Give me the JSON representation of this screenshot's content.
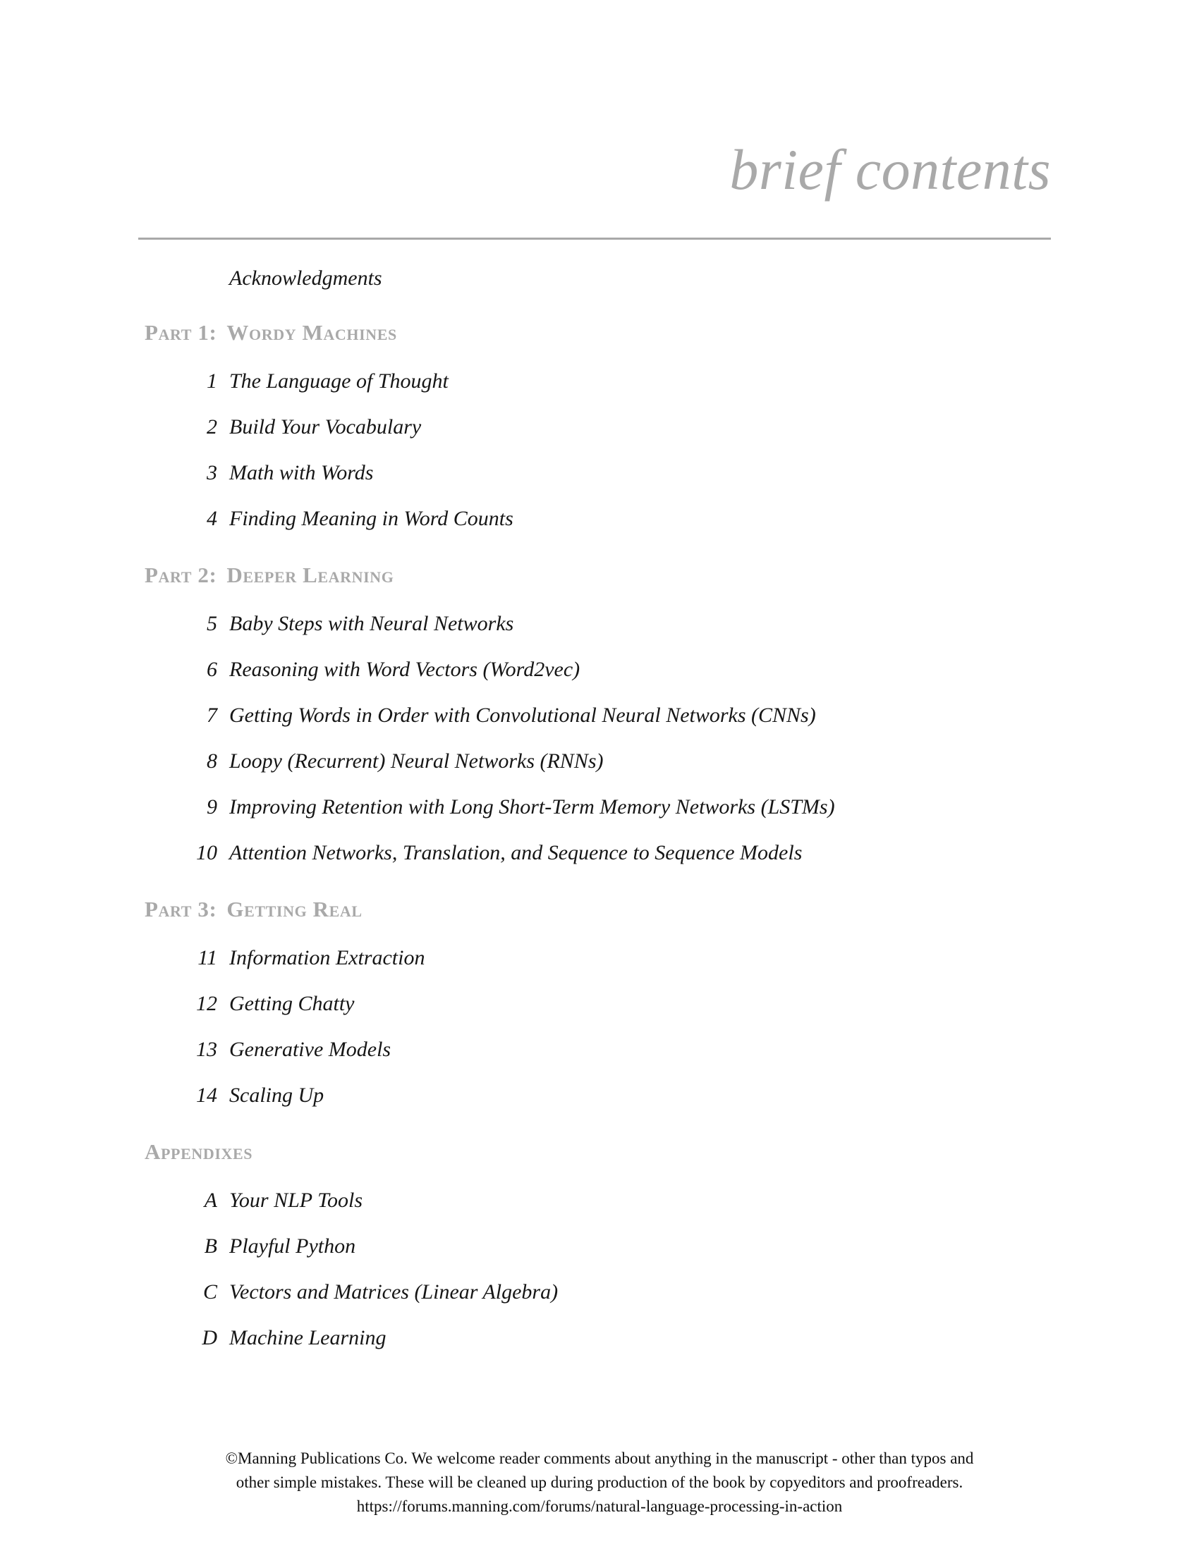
{
  "header": {
    "title": "brief contents",
    "rule_color": "#a9a9a9"
  },
  "colors": {
    "heading_gray": "#a9a9a9",
    "body_black": "#161616",
    "page_background": "#ffffff"
  },
  "contents": {
    "frontmatter": [
      {
        "label": "Acknowledgments"
      }
    ],
    "parts": [
      {
        "kicker": "Part 1:",
        "name": "Wordy Machines",
        "chapters": [
          {
            "number": "1",
            "title": "The Language of Thought"
          },
          {
            "number": "2",
            "title": "Build Your Vocabulary"
          },
          {
            "number": "3",
            "title": "Math with Words"
          },
          {
            "number": "4",
            "title": "Finding Meaning in Word Counts"
          }
        ]
      },
      {
        "kicker": "Part 2:",
        "name": "Deeper Learning",
        "chapters": [
          {
            "number": "5",
            "title": "Baby Steps with Neural Networks"
          },
          {
            "number": "6",
            "title": "Reasoning with Word Vectors (Word2vec)"
          },
          {
            "number": "7",
            "title": "Getting Words in Order with Convolutional Neural Networks (CNNs)"
          },
          {
            "number": "8",
            "title": "Loopy (Recurrent) Neural Networks (RNNs)"
          },
          {
            "number": "9",
            "title": "Improving Retention with Long Short-Term Memory Networks (LSTMs)"
          },
          {
            "number": "10",
            "title": "Attention Networks, Translation, and Sequence to Sequence Models"
          }
        ]
      },
      {
        "kicker": "Part 3:",
        "name": "Getting Real",
        "chapters": [
          {
            "number": "11",
            "title": "Information Extraction"
          },
          {
            "number": "12",
            "title": "Getting Chatty"
          },
          {
            "number": "13",
            "title": "Generative Models"
          },
          {
            "number": "14",
            "title": "Scaling Up"
          }
        ]
      }
    ],
    "appendixes": {
      "name": "Appendixes",
      "items": [
        {
          "number": "A",
          "title": "Your NLP Tools"
        },
        {
          "number": "B",
          "title": "Playful Python"
        },
        {
          "number": "C",
          "title": "Vectors and Matrices (Linear Algebra)"
        },
        {
          "number": "D",
          "title": "Machine Learning"
        }
      ]
    }
  },
  "footer": {
    "line1": "©Manning Publications Co. We welcome reader comments about anything in the manuscript - other than typos and",
    "line2": "other simple mistakes. These will be cleaned up during production of the book by copyeditors and proofreaders.",
    "line3": "https://forums.manning.com/forums/natural-language-processing-in-action"
  }
}
